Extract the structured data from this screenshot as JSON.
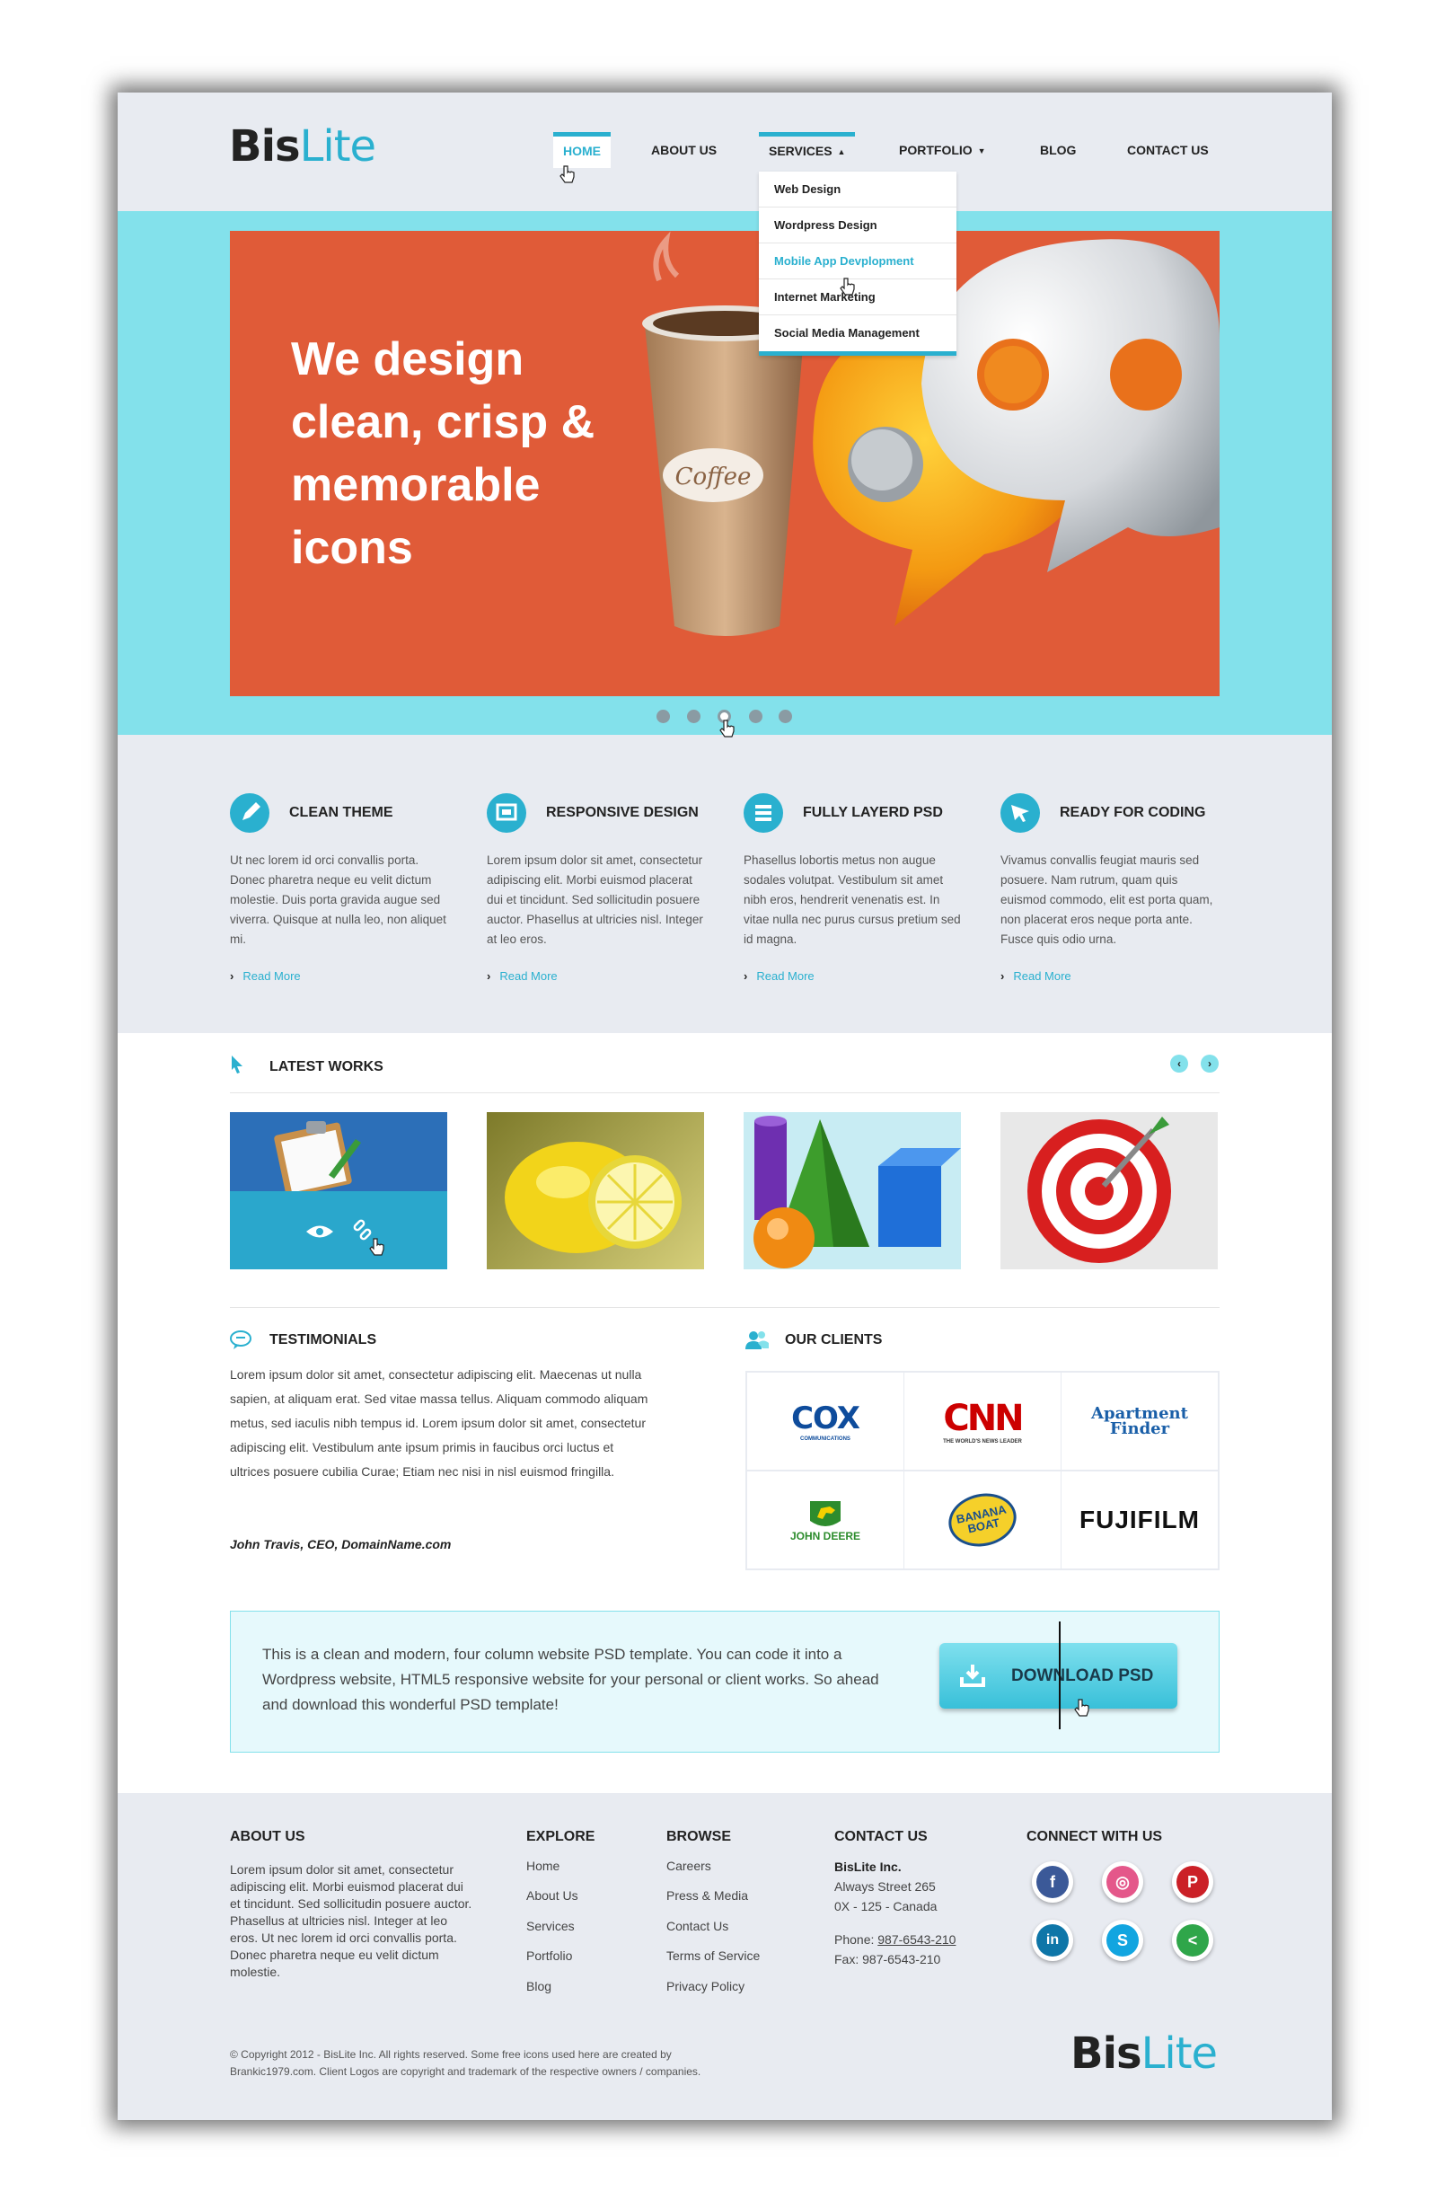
{
  "header": {
    "logo_bold": "Bis",
    "logo_light": "Lite",
    "nav": [
      {
        "label": "HOME"
      },
      {
        "label": "ABOUT US"
      },
      {
        "label": "SERVICES"
      },
      {
        "label": "PORTFOLIO"
      },
      {
        "label": "BLOG"
      },
      {
        "label": "CONTACT US"
      }
    ],
    "services_menu": [
      "Web Design",
      "Wordpress Design",
      "Mobile App Devplopment",
      "Internet Marketing",
      "Social Media Management"
    ]
  },
  "hero": {
    "lines": [
      "We design",
      "clean, crisp &",
      "memorable",
      "icons"
    ],
    "cup_label": "Coffee",
    "slide_count": 5,
    "active_slide": 3
  },
  "features": [
    {
      "title": "CLEAN THEME",
      "icon": "pencil-icon",
      "text": "Ut nec lorem id orci convallis porta. Donec pharetra neque eu velit dictum molestie. Duis porta gravida augue sed viverra. Quisque at nulla leo, non aliquet mi.",
      "more": "Read More"
    },
    {
      "title": "RESPONSIVE DESIGN",
      "icon": "screen-icon",
      "text": "Lorem ipsum dolor sit amet, consectetur adipiscing elit. Morbi euismod placerat dui et tincidunt. Sed sollicitudin posuere auctor. Phasellus at ultricies nisl. Integer at leo eros.",
      "more": "Read More"
    },
    {
      "title": "FULLY LAYERD PSD",
      "icon": "layers-icon",
      "text": "Phasellus lobortis metus non augue sodales volutpat. Vestibulum sit amet nibh eros, hendrerit venenatis est. In vitae nulla nec purus cursus pretium sed id magna.",
      "more": "Read More"
    },
    {
      "title": "READY FOR CODING",
      "icon": "cursor-icon",
      "text": "Vivamus convallis feugiat mauris sed posuere. Nam rutrum, quam quis euismod commodo, elit est porta quam, non placerat eros neque porta ante. Fusce quis odio urna.",
      "more": "Read More"
    }
  ],
  "works": {
    "title": "LATEST WORKS",
    "prev_label": "‹",
    "next_label": "›",
    "items": [
      "clipboard",
      "lemon",
      "shapes",
      "target"
    ]
  },
  "testimonials": {
    "title": "TESTIMONIALS",
    "text": "Lorem ipsum dolor sit amet, consectetur adipiscing elit. Maecenas ut nulla sapien, at aliquam erat. Sed vitae massa tellus. Aliquam commodo aliquam metus, sed iaculis nibh tempus id. Lorem ipsum dolor sit amet, consectetur adipiscing elit. Vestibulum ante ipsum primis in faucibus orci luctus et ultrices posuere cubilia Curae; Etiam nec nisi in nisl euismod fringilla.",
    "author": "John Travis, CEO, DomainName.com"
  },
  "clients": {
    "title": "OUR CLIENTS",
    "logos": [
      "COX",
      "CNN",
      "Apartment Finder",
      "JOHN DEERE",
      "BANANA BOAT",
      "FUJIFILM"
    ],
    "cox_sub": "COMMUNICATIONS",
    "cnn_sub": "THE WORLD'S NEWS LEADER"
  },
  "cta": {
    "text": "This is a clean and modern, four column website PSD template. You can code it into a Wordpress website, HTML5 responsive website for your personal or client works. So ahead and download this wonderful PSD template!",
    "button": "DOWNLOAD PSD"
  },
  "footer": {
    "about_title": "ABOUT US",
    "about_text": "Lorem ipsum dolor sit amet, consectetur adipiscing elit. Morbi euismod placerat dui et tincidunt. Sed sollicitudin posuere auctor. Phasellus at ultricies nisl. Integer at leo eros. Ut nec lorem id orci convallis porta. Donec pharetra neque eu velit dictum molestie.",
    "explore_title": "EXPLORE",
    "explore": [
      "Home",
      "About Us",
      "Services",
      "Portfolio",
      "Blog"
    ],
    "browse_title": "BROWSE",
    "browse": [
      "Careers",
      "Press & Media",
      "Contact Us",
      "Terms of Service",
      "Privacy Policy"
    ],
    "contact_title": "CONTACT US",
    "company": "BisLite Inc.",
    "address1": "Always Street 265",
    "address2": "0X - 125 - Canada",
    "phone_label": "Phone:",
    "phone": "987-6543-210",
    "fax": "Fax: 987-6543-210",
    "connect_title": "CONNECT WITH US",
    "copyright1": "© Copyright 2012 - BisLite Inc. All rights reserved. Some free icons used here are created by",
    "copyright2": "Brankic1979.com. Client Logos are copyright and trademark of the respective owners / companies."
  },
  "colors": {
    "accent": "#2ab0cf",
    "hero_bg": "#83e1eb",
    "slide_bg": "#e05b38",
    "panel": "#e8ebf1"
  }
}
